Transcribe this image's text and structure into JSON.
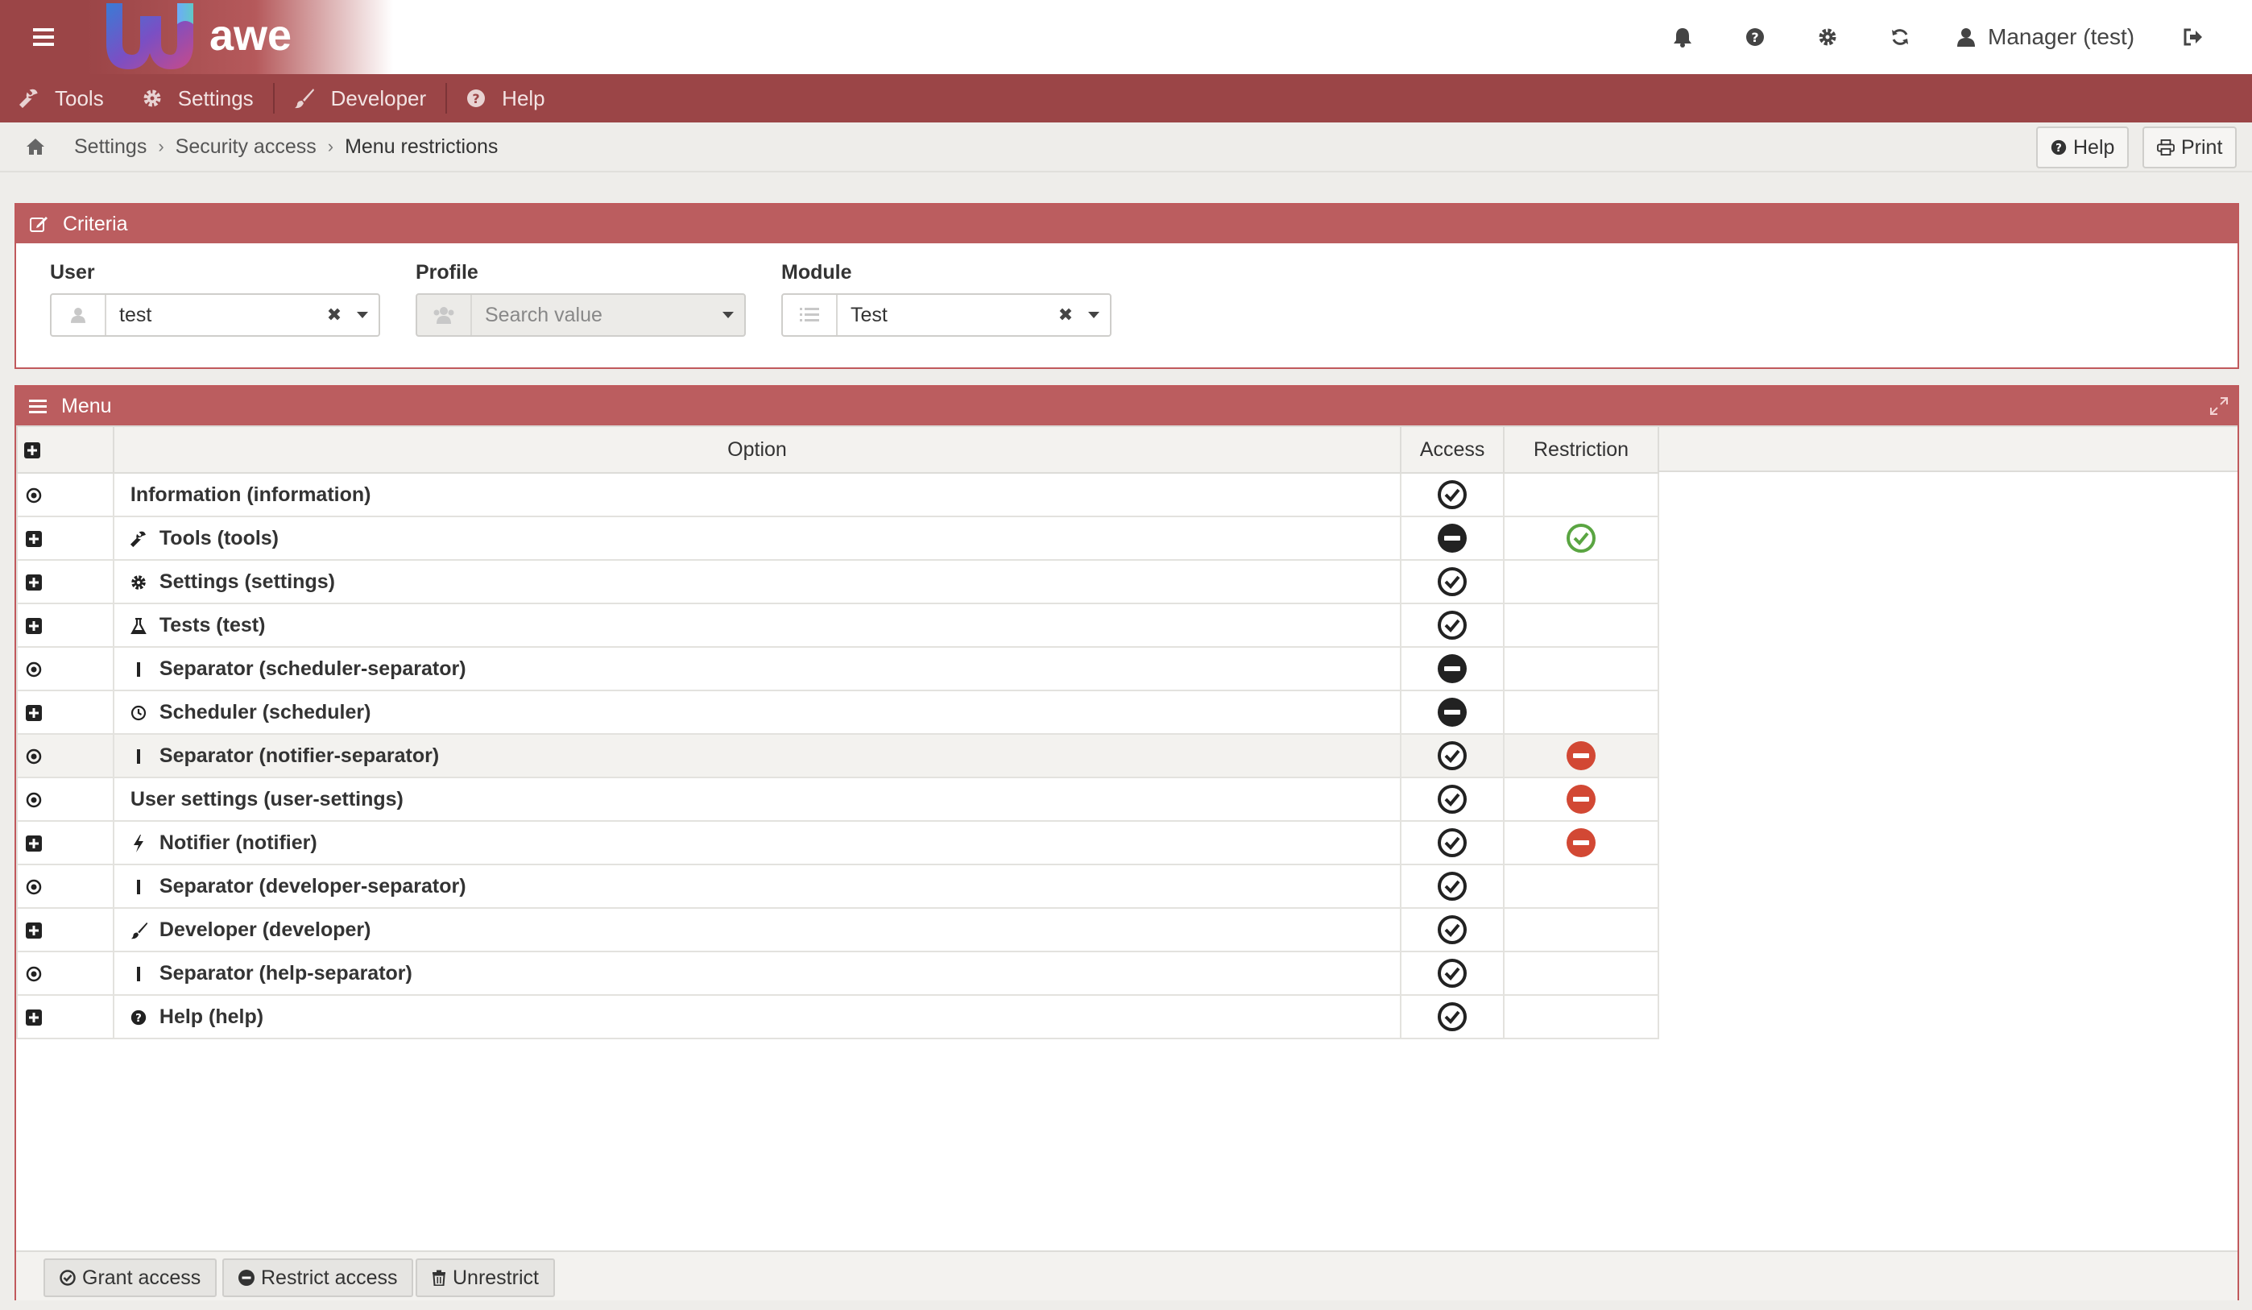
{
  "app": {
    "logo_text": "awe",
    "user_label": "Manager (test)"
  },
  "colors": {
    "brand": "#9b4547",
    "panel_header": "#bb5d5f",
    "granted": "#5aa542",
    "restricted": "#d24834",
    "neutral": "#222222"
  },
  "nav": {
    "items": [
      {
        "label": "Tools",
        "icon": "wrench-icon"
      },
      {
        "label": "Settings",
        "icon": "gear-icon"
      },
      {
        "label": "Developer",
        "icon": "brush-icon"
      },
      {
        "label": "Help",
        "icon": "question-icon"
      }
    ]
  },
  "breadcrumb": {
    "items": [
      "Settings",
      "Security access",
      "Menu restrictions"
    ]
  },
  "toolbar": {
    "help_label": "Help",
    "print_label": "Print"
  },
  "criteria": {
    "title": "Criteria",
    "user": {
      "label": "User",
      "value": "test"
    },
    "profile": {
      "label": "Profile",
      "placeholder": "Search value"
    },
    "module": {
      "label": "Module",
      "value": "Test"
    }
  },
  "menu": {
    "title": "Menu",
    "columns": {
      "option": "Option",
      "access": "Access",
      "restriction": "Restriction"
    },
    "rows": [
      {
        "ctl": "radio",
        "icon": "",
        "label": "Information (information)",
        "access": "check",
        "restriction": ""
      },
      {
        "ctl": "plus",
        "icon": "wrench-icon",
        "label": "Tools (tools)",
        "access": "minus",
        "restriction": "granted"
      },
      {
        "ctl": "plus",
        "icon": "gear-icon",
        "label": "Settings (settings)",
        "access": "check",
        "restriction": ""
      },
      {
        "ctl": "plus",
        "icon": "flask-icon",
        "label": "Tests (test)",
        "access": "check",
        "restriction": ""
      },
      {
        "ctl": "radio",
        "icon": "separator-icon",
        "label": "Separator (scheduler-separator)",
        "access": "minus",
        "restriction": ""
      },
      {
        "ctl": "plus",
        "icon": "clock-icon",
        "label": "Scheduler (scheduler)",
        "access": "minus",
        "restriction": ""
      },
      {
        "ctl": "radio",
        "icon": "separator-icon",
        "label": "Separator (notifier-separator)",
        "access": "check",
        "restriction": "restricted",
        "highlight": true
      },
      {
        "ctl": "radio",
        "icon": "",
        "label": "User settings (user-settings)",
        "access": "check",
        "restriction": "restricted"
      },
      {
        "ctl": "plus",
        "icon": "bolt-icon",
        "label": "Notifier (notifier)",
        "access": "check",
        "restriction": "restricted"
      },
      {
        "ctl": "radio",
        "icon": "separator-icon",
        "label": "Separator (developer-separator)",
        "access": "check",
        "restriction": ""
      },
      {
        "ctl": "plus",
        "icon": "brush-icon",
        "label": "Developer (developer)",
        "access": "check",
        "restriction": ""
      },
      {
        "ctl": "radio",
        "icon": "separator-icon",
        "label": "Separator (help-separator)",
        "access": "check",
        "restriction": ""
      },
      {
        "ctl": "plus",
        "icon": "question-icon",
        "label": "Help (help)",
        "access": "check",
        "restriction": ""
      }
    ]
  },
  "footer": {
    "grant_label": "Grant access",
    "restrict_label": "Restrict access",
    "unrestrict_label": "Unrestrict"
  }
}
